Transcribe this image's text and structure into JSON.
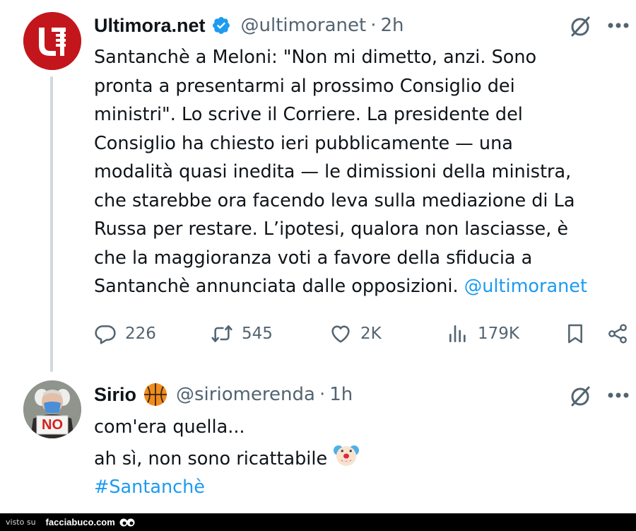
{
  "tweet1": {
    "display_name": "Ultimora.net",
    "handle": "@ultimoranet",
    "separator": "·",
    "time": "2h",
    "body_lines": [
      "Santanchè a Meloni: \"Non mi dimetto, anzi. Sono",
      "pronta a presentarmi al prossimo Consiglio dei",
      "ministri\". Lo scrive il Corriere. La presidente del",
      "Consiglio ha chiesto ieri pubblicamente — una",
      "modalità quasi inedita — le dimissioni della ministra,",
      "che starebbe ora facendo leva sulla mediazione di La",
      "Russa per restare. L’ipotesi, qualora non lasciasse, è",
      "che la maggioranza voti a favore della sfiducia a",
      "Santanchè annunciata dalle opposizioni."
    ],
    "mention": "@ultimoranet",
    "metrics": {
      "replies": "226",
      "reposts": "545",
      "likes": "2K",
      "views": "179K"
    }
  },
  "tweet2": {
    "display_name": "Sirio",
    "handle": "@siriomerenda",
    "separator": "·",
    "time": "1h",
    "body_lines": [
      "com'era quella...",
      "ah sì, non sono ricattabile"
    ],
    "hashtag": "#Santanchè",
    "avatar_sign": "NO"
  },
  "footer": {
    "visto_su": "visto su",
    "site": "facciabuco.com"
  },
  "colors": {
    "accent": "#1d9bf0",
    "secondary_text": "#536471",
    "avatar_red": "#c3161c"
  },
  "icons": {
    "reply": "speech-bubble-icon",
    "repost": "repost-arrows-icon",
    "like": "heart-icon",
    "views": "bar-chart-icon",
    "bookmark": "bookmark-icon",
    "share": "share-icon",
    "grok": "grok-slash-icon",
    "more": "more-dots-icon",
    "verified": "verified-badge-icon",
    "basketball": "basketball-emoji-icon",
    "clown": "clown-emoji-icon"
  }
}
